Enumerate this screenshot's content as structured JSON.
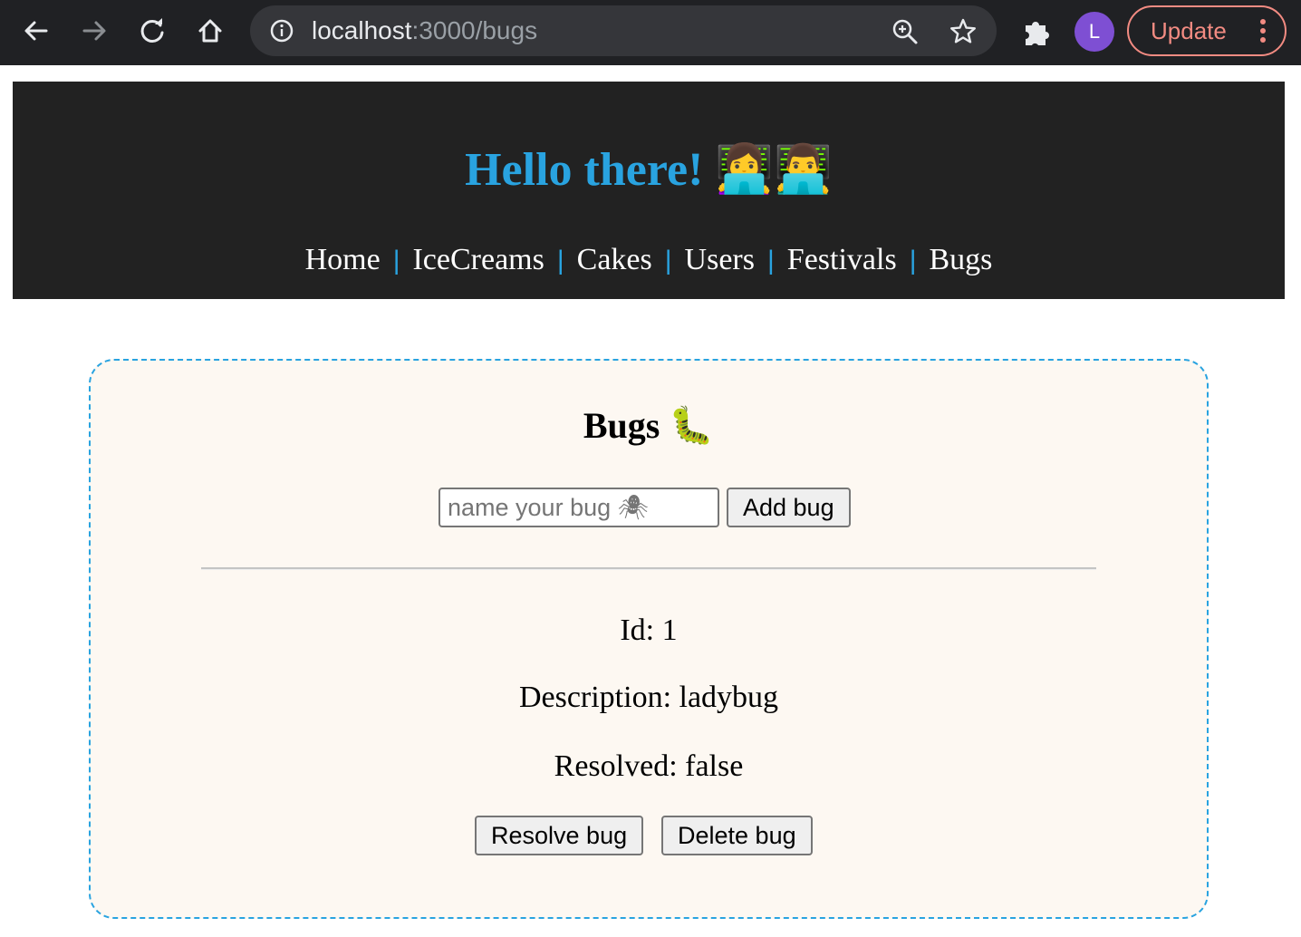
{
  "browser": {
    "url_host": "localhost",
    "url_path": ":3000/bugs",
    "avatar_letter": "L",
    "update_label": "Update",
    "icons": [
      "back-icon",
      "forward-icon",
      "reload-icon",
      "home-icon",
      "info-icon",
      "zoom-icon",
      "star-icon",
      "extensions-icon",
      "kebab-menu-icon"
    ]
  },
  "header": {
    "title": "Hello there!",
    "title_emoji": "👩‍💻👨‍💻",
    "nav": [
      "Home",
      "IceCreams",
      "Cakes",
      "Users",
      "Festivals",
      "Bugs"
    ],
    "separator": "|"
  },
  "bugs": {
    "title": "Bugs 🐛",
    "input_placeholder": "name your bug 🕷",
    "add_button": "Add bug",
    "items": [
      {
        "id_line": "Id: 1",
        "description_line": "Description: ladybug",
        "resolved_line": "Resolved: false",
        "resolve_button": "Resolve bug",
        "delete_button": "Delete bug"
      }
    ]
  },
  "colors": {
    "chrome_bg": "#202124",
    "omnibox_bg": "#35363a",
    "header_bg": "#222222",
    "accent_blue": "#29a3e0",
    "card_bg": "#fdf8f2",
    "update_red": "#f28b82",
    "avatar_purple": "#7e4fd3"
  }
}
